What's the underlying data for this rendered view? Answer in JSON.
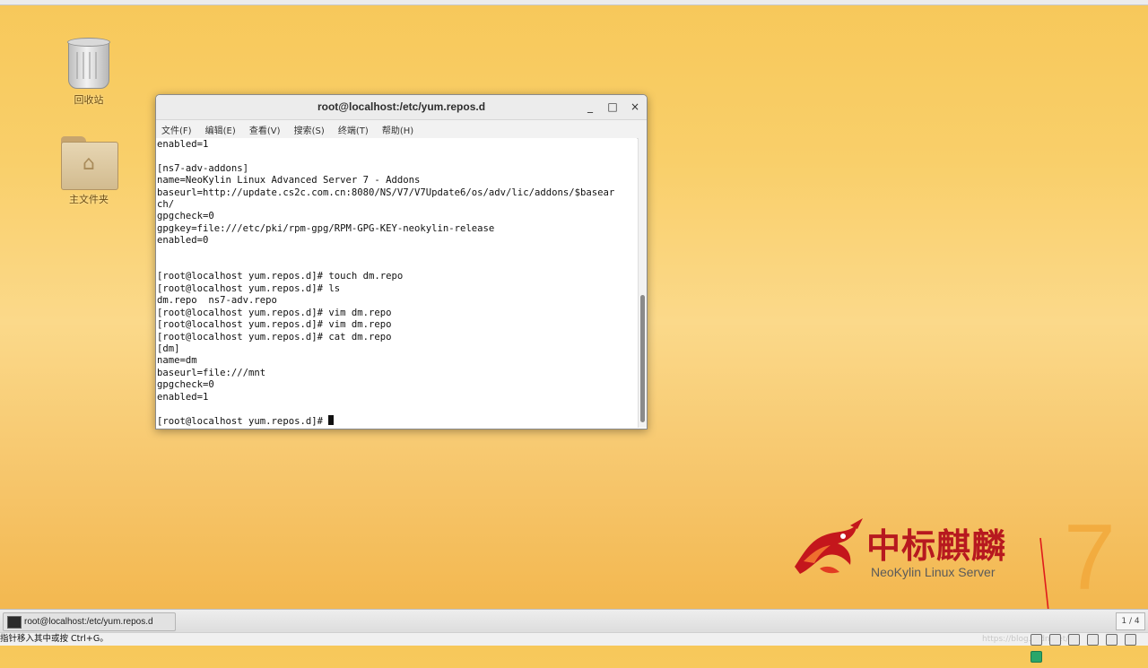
{
  "desktop": {
    "icons": [
      {
        "label": "回收站",
        "icon": "trash-icon"
      },
      {
        "label": "主文件夹",
        "icon": "home-folder-icon"
      }
    ],
    "brand": {
      "cn": "中标麒麟",
      "en": "NeoKylin Linux Server",
      "version": "7",
      "colors": {
        "cn": "#b7191f",
        "version": "#f2a93b"
      }
    }
  },
  "window": {
    "title": "root@localhost:/etc/yum.repos.d",
    "controls": {
      "minimize": "_",
      "maximize": "□",
      "close": "×"
    },
    "menu": [
      "文件(F)",
      "编辑(E)",
      "查看(V)",
      "搜索(S)",
      "终端(T)",
      "帮助(H)"
    ],
    "terminal_lines": [
      "enabled=1",
      "",
      "[ns7-adv-addons]",
      "name=NeoKylin Linux Advanced Server 7 - Addons",
      "baseurl=http://update.cs2c.com.cn:8080/NS/V7/V7Update6/os/adv/lic/addons/$basear",
      "ch/",
      "gpgcheck=0",
      "gpgkey=file:///etc/pki/rpm-gpg/RPM-GPG-KEY-neokylin-release",
      "enabled=0",
      "",
      "",
      "[root@localhost yum.repos.d]# touch dm.repo",
      "[root@localhost yum.repos.d]# ls",
      "dm.repo  ns7-adv.repo",
      "[root@localhost yum.repos.d]# vim dm.repo",
      "[root@localhost yum.repos.d]# vim dm.repo",
      "[root@localhost yum.repos.d]# cat dm.repo",
      "[dm]",
      "name=dm",
      "baseurl=file:///mnt",
      "gpgcheck=0",
      "enabled=1",
      ""
    ],
    "prompt": "[root@localhost yum.repos.d]# "
  },
  "taskbar": {
    "task_label": "root@localhost:/etc/yum.repos.d",
    "workspace": "1 / 4"
  },
  "statusbar": {
    "text": "指针移入其中或按 Ctrl+G。",
    "watermark": "https://blog.csdn.net/..."
  }
}
